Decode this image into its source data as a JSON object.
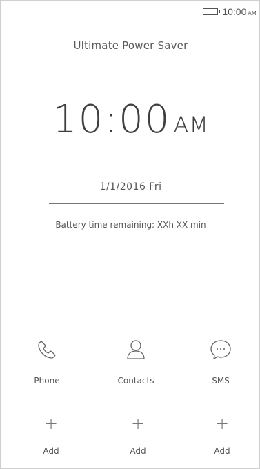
{
  "status_bar": {
    "time": "10:00",
    "ampm": "AM"
  },
  "title": "Ultimate Power Saver",
  "clock": {
    "time": "10:00",
    "ampm": "AM"
  },
  "date": "1/1/2016 Fri",
  "battery_remaining": "Battery time remaining: XXh XX min",
  "apps": [
    {
      "label": "Phone",
      "icon": "phone-icon"
    },
    {
      "label": "Contacts",
      "icon": "person-icon"
    },
    {
      "label": "SMS",
      "icon": "chat-bubble-icon"
    }
  ],
  "add_slots": [
    {
      "label": "Add",
      "icon": "plus-icon"
    },
    {
      "label": "Add",
      "icon": "plus-icon"
    },
    {
      "label": "Add",
      "icon": "plus-icon"
    }
  ]
}
